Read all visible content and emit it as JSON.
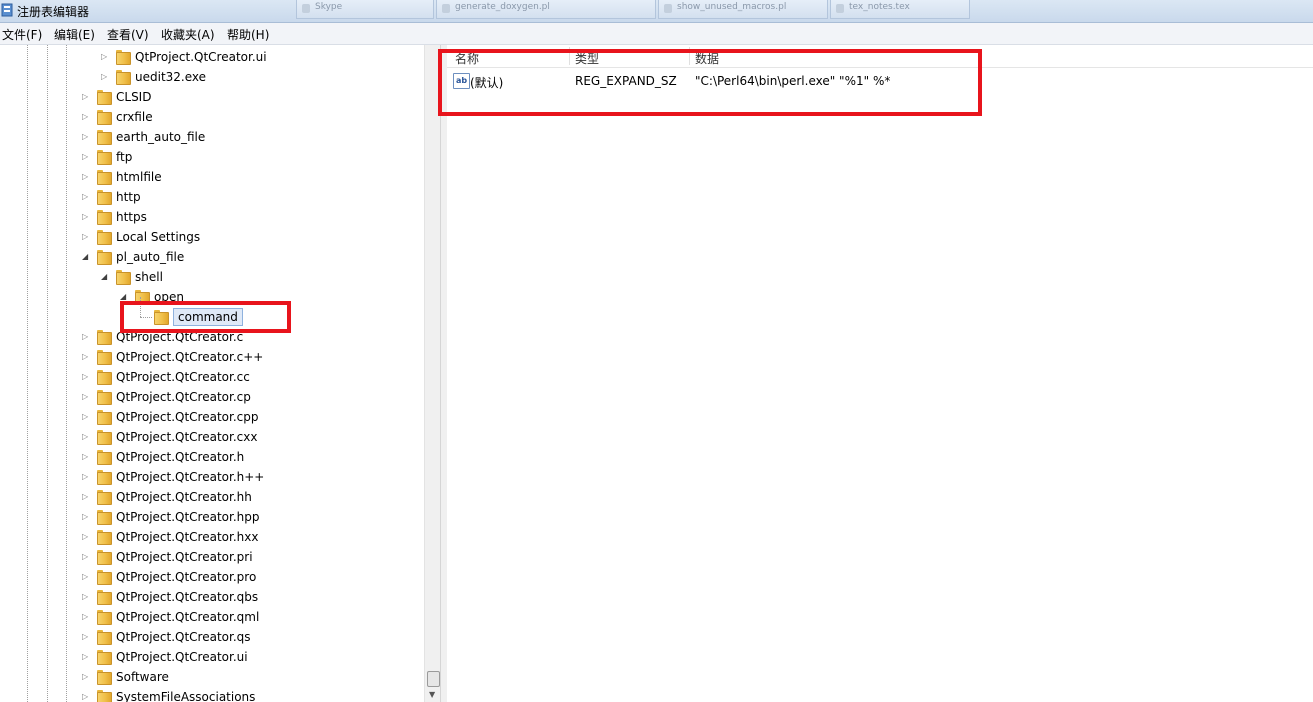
{
  "window": {
    "title": "注册表编辑器",
    "background_tasks": [
      "Skype",
      "generate_doxygen.pl",
      "show_unused_macros.pl",
      "tex_notes.tex"
    ]
  },
  "menu": [
    "文件(F)",
    "编辑(E)",
    "查看(V)",
    "收藏夹(A)",
    "帮助(H)"
  ],
  "tree": {
    "nodes": [
      {
        "label": "QtProject.QtCreator.ui",
        "depth": 2,
        "arrow": "collapsed"
      },
      {
        "label": "uedit32.exe",
        "depth": 2,
        "arrow": "collapsed"
      },
      {
        "label": "CLSID",
        "depth": 1,
        "arrow": "collapsed"
      },
      {
        "label": "crxfile",
        "depth": 1,
        "arrow": "collapsed"
      },
      {
        "label": "earth_auto_file",
        "depth": 1,
        "arrow": "collapsed"
      },
      {
        "label": "ftp",
        "depth": 1,
        "arrow": "collapsed"
      },
      {
        "label": "htmlfile",
        "depth": 1,
        "arrow": "collapsed"
      },
      {
        "label": "http",
        "depth": 1,
        "arrow": "collapsed"
      },
      {
        "label": "https",
        "depth": 1,
        "arrow": "collapsed"
      },
      {
        "label": "Local Settings",
        "depth": 1,
        "arrow": "collapsed"
      },
      {
        "label": "pl_auto_file",
        "depth": 1,
        "arrow": "expanded"
      },
      {
        "label": "shell",
        "depth": 2,
        "arrow": "expanded"
      },
      {
        "label": "open",
        "depth": 3,
        "arrow": "expanded"
      },
      {
        "label": "command",
        "depth": 4,
        "arrow": "none",
        "selected": true
      },
      {
        "label": "QtProject.QtCreator.c",
        "depth": 1,
        "arrow": "collapsed"
      },
      {
        "label": "QtProject.QtCreator.c++",
        "depth": 1,
        "arrow": "collapsed"
      },
      {
        "label": "QtProject.QtCreator.cc",
        "depth": 1,
        "arrow": "collapsed"
      },
      {
        "label": "QtProject.QtCreator.cp",
        "depth": 1,
        "arrow": "collapsed"
      },
      {
        "label": "QtProject.QtCreator.cpp",
        "depth": 1,
        "arrow": "collapsed"
      },
      {
        "label": "QtProject.QtCreator.cxx",
        "depth": 1,
        "arrow": "collapsed"
      },
      {
        "label": "QtProject.QtCreator.h",
        "depth": 1,
        "arrow": "collapsed"
      },
      {
        "label": "QtProject.QtCreator.h++",
        "depth": 1,
        "arrow": "collapsed"
      },
      {
        "label": "QtProject.QtCreator.hh",
        "depth": 1,
        "arrow": "collapsed"
      },
      {
        "label": "QtProject.QtCreator.hpp",
        "depth": 1,
        "arrow": "collapsed"
      },
      {
        "label": "QtProject.QtCreator.hxx",
        "depth": 1,
        "arrow": "collapsed"
      },
      {
        "label": "QtProject.QtCreator.pri",
        "depth": 1,
        "arrow": "collapsed"
      },
      {
        "label": "QtProject.QtCreator.pro",
        "depth": 1,
        "arrow": "collapsed"
      },
      {
        "label": "QtProject.QtCreator.qbs",
        "depth": 1,
        "arrow": "collapsed"
      },
      {
        "label": "QtProject.QtCreator.qml",
        "depth": 1,
        "arrow": "collapsed"
      },
      {
        "label": "QtProject.QtCreator.qs",
        "depth": 1,
        "arrow": "collapsed"
      },
      {
        "label": "QtProject.QtCreator.ui",
        "depth": 1,
        "arrow": "collapsed"
      },
      {
        "label": "Software",
        "depth": 1,
        "arrow": "collapsed"
      },
      {
        "label": "SystemFileAssociations",
        "depth": 1,
        "arrow": "collapsed"
      }
    ]
  },
  "values": {
    "columns": [
      "名称",
      "类型",
      "数据"
    ],
    "rows": [
      {
        "icon": "ab",
        "name": "(默认)",
        "type": "REG_EXPAND_SZ",
        "data": "\"C:\\Perl64\\bin\\perl.exe\" \"%1\" %*"
      }
    ]
  },
  "colors": {
    "highlight_box": "#e8141c",
    "selection_bg": "#dfe9f7",
    "folder_yellow": "#f0c04a"
  },
  "icons": [
    "regedit-app-icon",
    "folder-icon",
    "expand-arrow-icon",
    "collapse-arrow-icon",
    "string-value-ab-icon",
    "scroll-down-arrow-icon"
  ]
}
